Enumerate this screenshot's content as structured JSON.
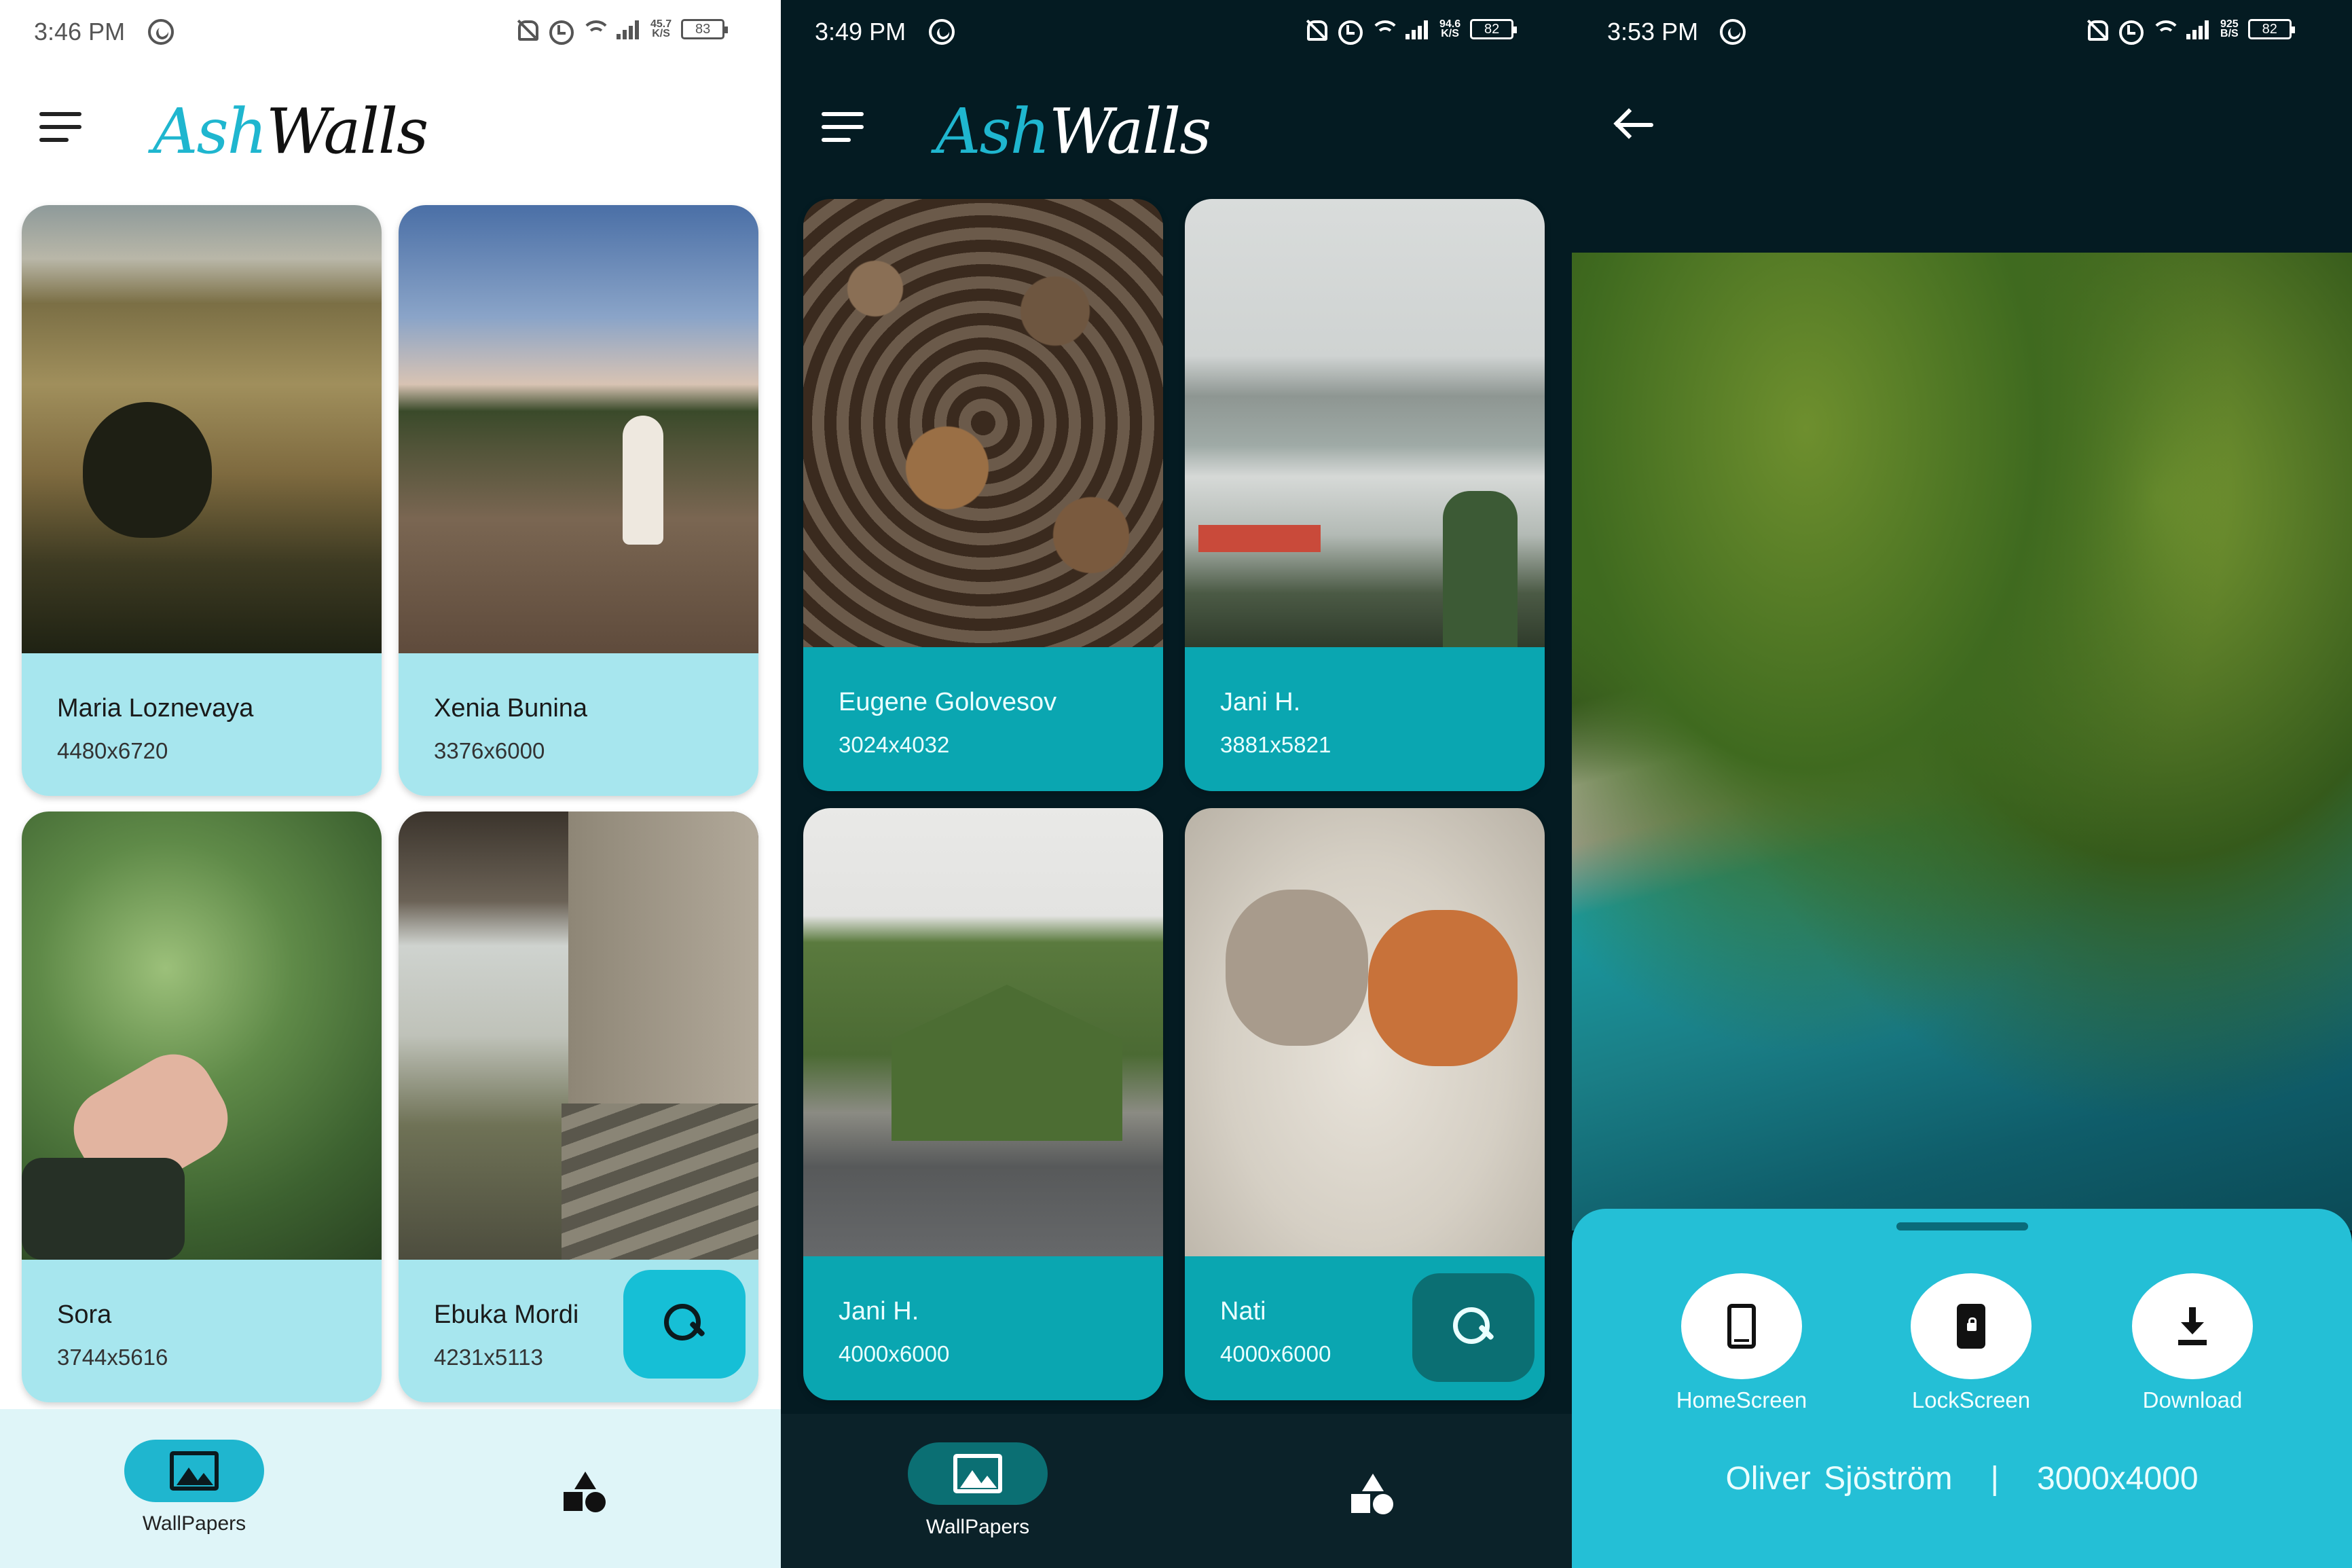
{
  "app": {
    "name_part1": "Ash",
    "name_part2": "Walls"
  },
  "colors": {
    "accent": "#1fb6cf",
    "light_caption": "#a7e6ee",
    "dark_caption": "#0aa6b1",
    "dark_bg": "#041b22",
    "sheet": "#24bfd6"
  },
  "screen1": {
    "status": {
      "time": "3:46 PM",
      "speed_top": "45.7",
      "speed_bottom": "K/S",
      "battery": "83"
    },
    "cards": [
      {
        "name": "Maria Loznevaya",
        "resolution": "4480x6720"
      },
      {
        "name": "Xenia Bunina",
        "resolution": "3376x6000"
      },
      {
        "name": "Sora",
        "resolution": "3744x5616"
      },
      {
        "name": "Ebuka Mordi",
        "resolution": "4231x5113"
      }
    ],
    "nav": {
      "wallpapers_label": "WallPapers"
    }
  },
  "screen2": {
    "status": {
      "time": "3:49 PM",
      "speed_top": "94.6",
      "speed_bottom": "K/S",
      "battery": "82"
    },
    "cards": [
      {
        "name": "Eugene Golovesov",
        "resolution": "3024x4032"
      },
      {
        "name": "Jani H.",
        "resolution": "3881x5821"
      },
      {
        "name": "Jani H.",
        "resolution": "4000x6000"
      },
      {
        "name": "Nati",
        "resolution": "4000x6000"
      }
    ],
    "nav": {
      "wallpapers_label": "WallPapers"
    }
  },
  "screen3": {
    "status": {
      "time": "3:53 PM",
      "speed_top": "925",
      "speed_bottom": "B/S",
      "battery": "82"
    },
    "actions": [
      {
        "label": "HomeScreen",
        "icon": "phone-icon"
      },
      {
        "label": "LockScreen",
        "icon": "lock-screen-icon"
      },
      {
        "label": "Download",
        "icon": "download-icon"
      }
    ],
    "credit": {
      "author": "Oliver Sjöström",
      "separator": "|",
      "resolution": "3000x4000"
    }
  }
}
